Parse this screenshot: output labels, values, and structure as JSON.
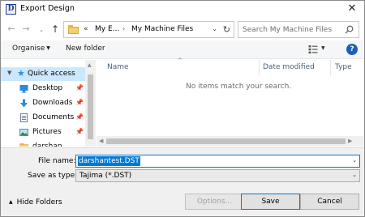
{
  "window": {
    "title": "Export Design",
    "app_icon_letter": "D",
    "close_glyph": "✕"
  },
  "nav": {
    "back": "←",
    "forward": "→",
    "recent": "⌄",
    "up": "↑"
  },
  "address": {
    "overflow": "«",
    "crumbs": [
      "My E...",
      "My Machine Files"
    ],
    "separator": "›",
    "dropdown": "⌄",
    "refresh": "↻"
  },
  "search": {
    "placeholder": "Search My Machine Files"
  },
  "toolbar": {
    "organise": "Organise",
    "organise_caret": "▼",
    "new_folder": "New folder",
    "view_caret": "▼",
    "help": "?"
  },
  "sidebar": {
    "items": [
      {
        "label": "Quick access",
        "icon": "star-icon",
        "selected": true
      },
      {
        "label": "Desktop",
        "icon": "desktop-icon",
        "pinned": true
      },
      {
        "label": "Downloads",
        "icon": "downloads-icon",
        "pinned": true
      },
      {
        "label": "Documents",
        "icon": "documents-icon",
        "pinned": true
      },
      {
        "label": "Pictures",
        "icon": "pictures-icon",
        "pinned": true
      },
      {
        "label": "darshan",
        "icon": "folder-icon",
        "pinned": false
      }
    ]
  },
  "list": {
    "columns": [
      "Name",
      "Date modified",
      "Type"
    ],
    "empty_message": "No items match your search."
  },
  "form": {
    "file_name_label": "File name:",
    "file_name_value": "darshantest.DST",
    "save_as_label": "Save as type:",
    "save_as_value": "Tajima (*.DST)"
  },
  "footer": {
    "hide_folders": "Hide Folders",
    "options": "Options...",
    "save": "Save",
    "cancel": "Cancel"
  },
  "colors": {
    "accent": "#0078d7",
    "selection": "#cce8ff",
    "help": "#1c5fb8"
  }
}
